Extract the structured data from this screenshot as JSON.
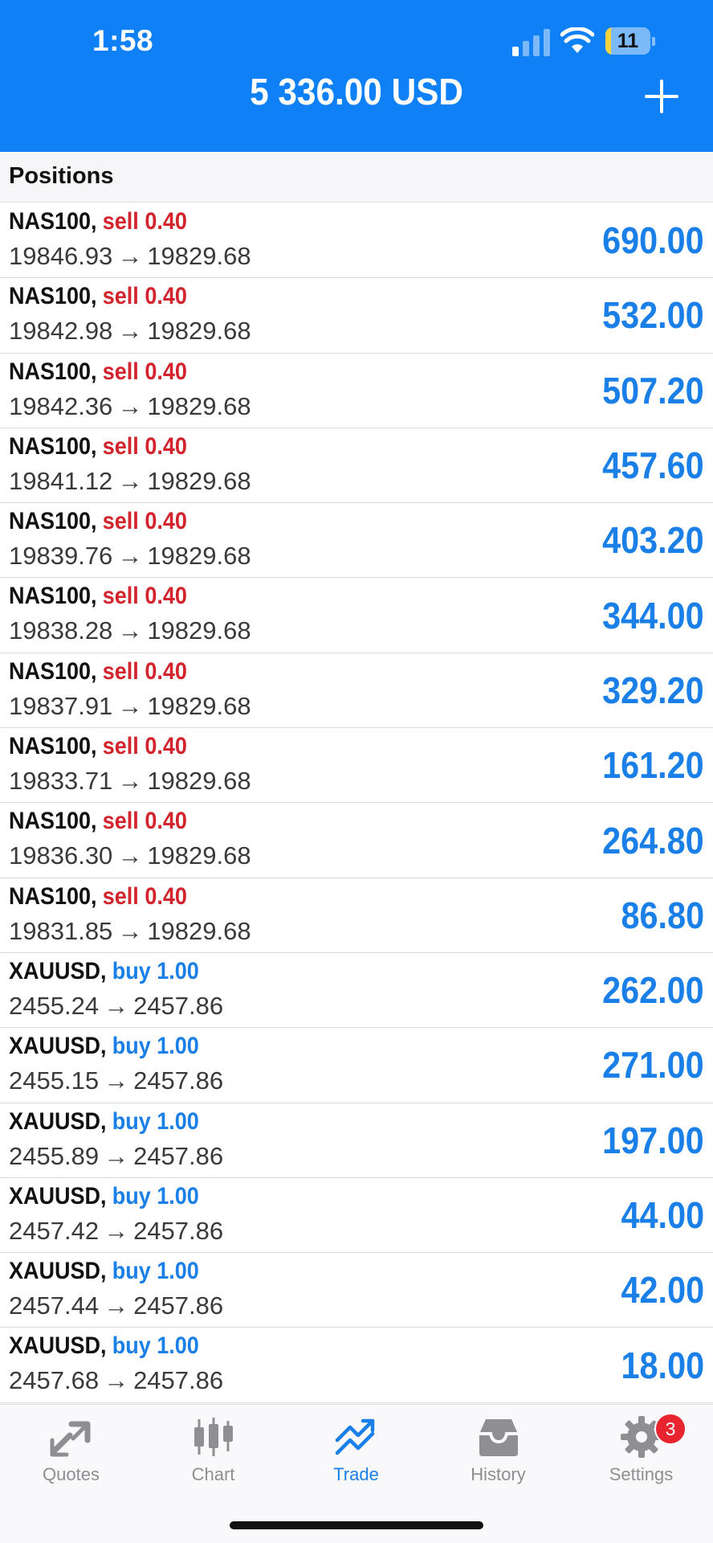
{
  "status_bar": {
    "time": "1:58",
    "battery_level": "11",
    "battery_fraction": 0.11,
    "signal_bars_filled": 1,
    "signal_bars_total": 4
  },
  "header": {
    "balance": "5 336.00 USD",
    "add_icon": "plus-icon"
  },
  "section": {
    "title": "Positions"
  },
  "positions": [
    {
      "symbol": "NAS100,",
      "action": "sell",
      "volume": "0.40",
      "open_price": "19846.93",
      "current_price": "19829.68",
      "profit": "690.00"
    },
    {
      "symbol": "NAS100,",
      "action": "sell",
      "volume": "0.40",
      "open_price": "19842.98",
      "current_price": "19829.68",
      "profit": "532.00"
    },
    {
      "symbol": "NAS100,",
      "action": "sell",
      "volume": "0.40",
      "open_price": "19842.36",
      "current_price": "19829.68",
      "profit": "507.20"
    },
    {
      "symbol": "NAS100,",
      "action": "sell",
      "volume": "0.40",
      "open_price": "19841.12",
      "current_price": "19829.68",
      "profit": "457.60"
    },
    {
      "symbol": "NAS100,",
      "action": "sell",
      "volume": "0.40",
      "open_price": "19839.76",
      "current_price": "19829.68",
      "profit": "403.20"
    },
    {
      "symbol": "NAS100,",
      "action": "sell",
      "volume": "0.40",
      "open_price": "19838.28",
      "current_price": "19829.68",
      "profit": "344.00"
    },
    {
      "symbol": "NAS100,",
      "action": "sell",
      "volume": "0.40",
      "open_price": "19837.91",
      "current_price": "19829.68",
      "profit": "329.20"
    },
    {
      "symbol": "NAS100,",
      "action": "sell",
      "volume": "0.40",
      "open_price": "19833.71",
      "current_price": "19829.68",
      "profit": "161.20"
    },
    {
      "symbol": "NAS100,",
      "action": "sell",
      "volume": "0.40",
      "open_price": "19836.30",
      "current_price": "19829.68",
      "profit": "264.80"
    },
    {
      "symbol": "NAS100,",
      "action": "sell",
      "volume": "0.40",
      "open_price": "19831.85",
      "current_price": "19829.68",
      "profit": "86.80"
    },
    {
      "symbol": "XAUUSD,",
      "action": "buy",
      "volume": "1.00",
      "open_price": "2455.24",
      "current_price": "2457.86",
      "profit": "262.00"
    },
    {
      "symbol": "XAUUSD,",
      "action": "buy",
      "volume": "1.00",
      "open_price": "2455.15",
      "current_price": "2457.86",
      "profit": "271.00"
    },
    {
      "symbol": "XAUUSD,",
      "action": "buy",
      "volume": "1.00",
      "open_price": "2455.89",
      "current_price": "2457.86",
      "profit": "197.00"
    },
    {
      "symbol": "XAUUSD,",
      "action": "buy",
      "volume": "1.00",
      "open_price": "2457.42",
      "current_price": "2457.86",
      "profit": "44.00"
    },
    {
      "symbol": "XAUUSD,",
      "action": "buy",
      "volume": "1.00",
      "open_price": "2457.44",
      "current_price": "2457.86",
      "profit": "42.00"
    },
    {
      "symbol": "XAUUSD,",
      "action": "buy",
      "volume": "1.00",
      "open_price": "2457.68",
      "current_price": "2457.86",
      "profit": "18.00"
    }
  ],
  "arrow_glyph": "→",
  "tabs": [
    {
      "label": "Quotes",
      "icon": "quotes-icon",
      "active": false
    },
    {
      "label": "Chart",
      "icon": "chart-icon",
      "active": false
    },
    {
      "label": "Trade",
      "icon": "trade-icon",
      "active": true
    },
    {
      "label": "History",
      "icon": "history-icon",
      "active": false
    },
    {
      "label": "Settings",
      "icon": "settings-icon",
      "active": false,
      "badge": "3"
    }
  ],
  "colors": {
    "header_bg": "#0f80f5",
    "sell": "#d3232d",
    "buy": "#1a7fe6",
    "profit": "#1a7fe6",
    "tab_active": "#1a7fe6",
    "tab_inactive": "#8e8e93",
    "badge": "#e8242f"
  }
}
